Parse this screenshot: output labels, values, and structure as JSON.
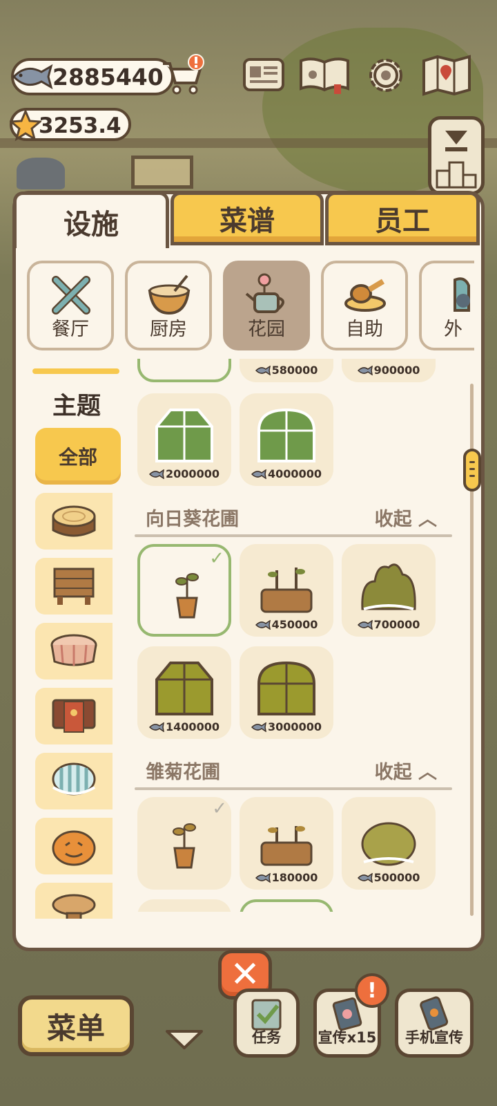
{
  "hud": {
    "fish_coins": "2885440",
    "stars": "3253.4"
  },
  "tabs": [
    {
      "label": "设施",
      "active": true
    },
    {
      "label": "菜谱",
      "active": false
    },
    {
      "label": "员工",
      "active": false
    }
  ],
  "categories": [
    {
      "label": "餐厅",
      "icon": "tools-icon",
      "selected": false
    },
    {
      "label": "厨房",
      "icon": "mixing-bowl-icon",
      "selected": false
    },
    {
      "label": "花园",
      "icon": "watering-can-icon",
      "selected": true
    },
    {
      "label": "自助",
      "icon": "buffet-icon",
      "selected": false
    },
    {
      "label": "外",
      "icon": "takeout-icon",
      "selected": false
    }
  ],
  "sidebar": {
    "title": "主题",
    "all_label": "全部",
    "themes": [
      "log-stump-icon",
      "wooden-table-icon",
      "picnic-table-icon",
      "paw-table-icon",
      "striped-stool-icon",
      "pumpkin-icon",
      "round-stool-icon"
    ]
  },
  "content": {
    "prev_prices": [
      "580000",
      "900000"
    ],
    "prev_greenhouses": [
      {
        "price": "2000000"
      },
      {
        "price": "4000000"
      }
    ],
    "sections": [
      {
        "name": "向日葵花圃",
        "toggle": "收起",
        "items": [
          {
            "owned": true,
            "price": "",
            "art": "sprout-pot-icon"
          },
          {
            "owned": false,
            "price": "450000",
            "art": "sprout-bed-icon"
          },
          {
            "owned": false,
            "price": "700000",
            "art": "bush-icon"
          },
          {
            "owned": false,
            "price": "1400000",
            "art": "greenhouse-icon"
          },
          {
            "owned": false,
            "price": "3000000",
            "art": "dome-greenhouse-icon"
          }
        ]
      },
      {
        "name": "雏菊花圃",
        "toggle": "收起",
        "items": [
          {
            "owned": true,
            "price": "",
            "art": "sprout-pot-icon"
          },
          {
            "owned": false,
            "price": "180000",
            "art": "sprout-bed-icon"
          },
          {
            "owned": false,
            "price": "500000",
            "art": "bush-icon"
          }
        ]
      }
    ]
  },
  "bottom": {
    "menu_label": "菜单",
    "task_label": "任务",
    "promo_label": "宣传x15",
    "phone_promo_label": "手机宣传"
  },
  "colors": {
    "accent_yellow": "#f7c84e",
    "panel_bg": "#fbf5ea",
    "border_brown": "#6a5542",
    "owned_green": "#97b870",
    "close_orange": "#ee6f3d"
  }
}
